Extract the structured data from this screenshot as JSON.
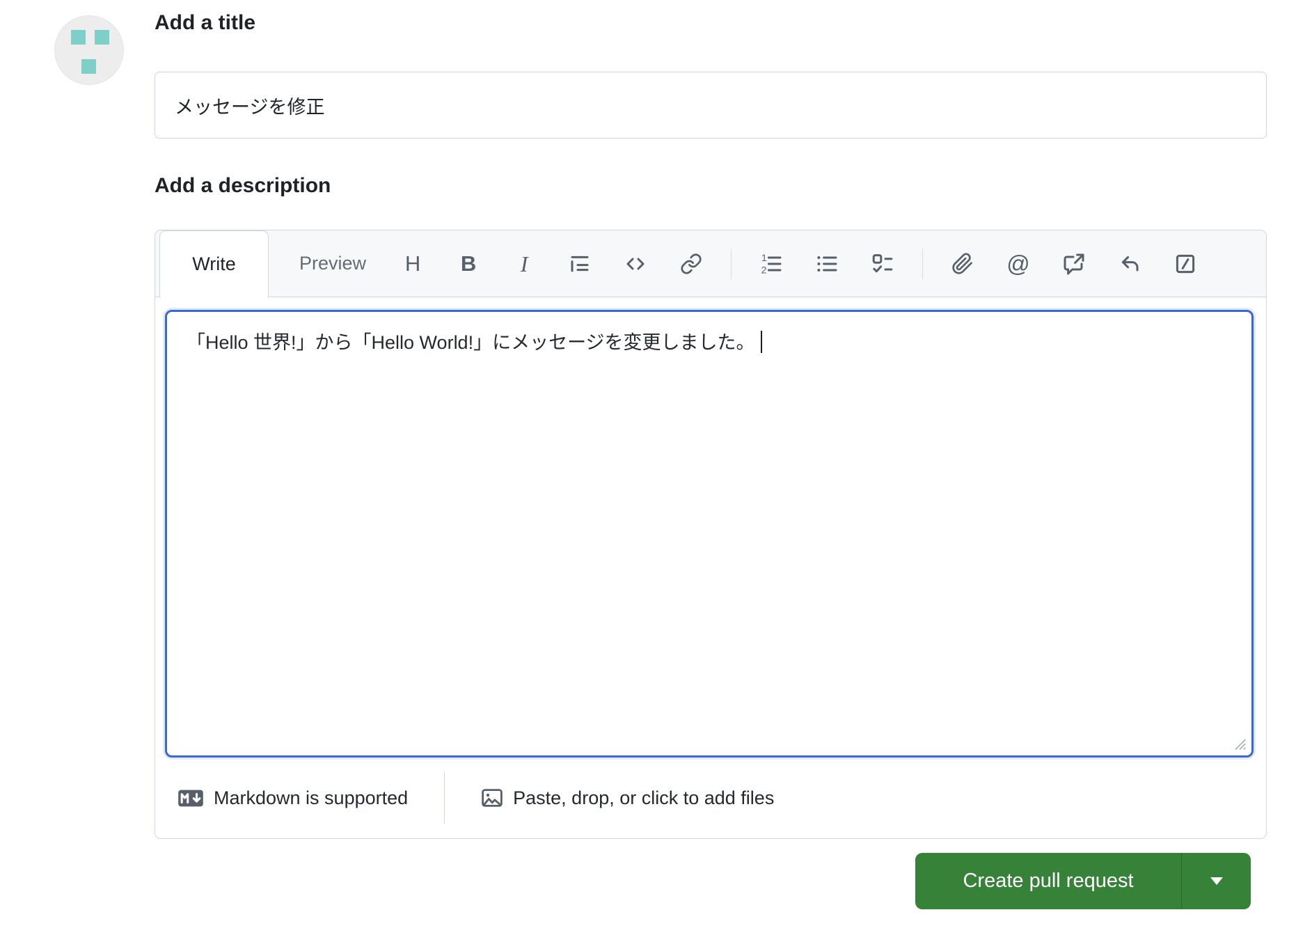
{
  "title_section": {
    "heading": "Add a title",
    "input_value": "メッセージを修正"
  },
  "description_section": {
    "heading": "Add a description",
    "tabs": {
      "write": "Write",
      "preview": "Preview"
    },
    "toolbar_glyphs": {
      "heading": "H",
      "bold": "B",
      "italic": "I",
      "mention": "@"
    },
    "toolbar_icons": [
      "heading",
      "bold",
      "italic",
      "quote",
      "code",
      "link",
      "ordered-list",
      "unordered-list",
      "task-list",
      "attach-file",
      "mention",
      "cross-reference",
      "saved-replies",
      "slash-commands"
    ],
    "body_text": "「Hello 世界!」から「Hello World!」にメッセージを変更しました。",
    "footer": {
      "markdown_note": "Markdown is supported",
      "paste_note": "Paste, drop, or click to add files"
    }
  },
  "actions": {
    "create_button_label": "Create pull request"
  },
  "colors": {
    "accent_green": "#378239",
    "focus_blue": "#3b67d6",
    "border_gray": "#d0d7de",
    "header_bg": "#f6f8fa",
    "icon_gray": "#57606a",
    "identicon_teal": "#7fcfc9",
    "avatar_bg": "#ededee"
  }
}
